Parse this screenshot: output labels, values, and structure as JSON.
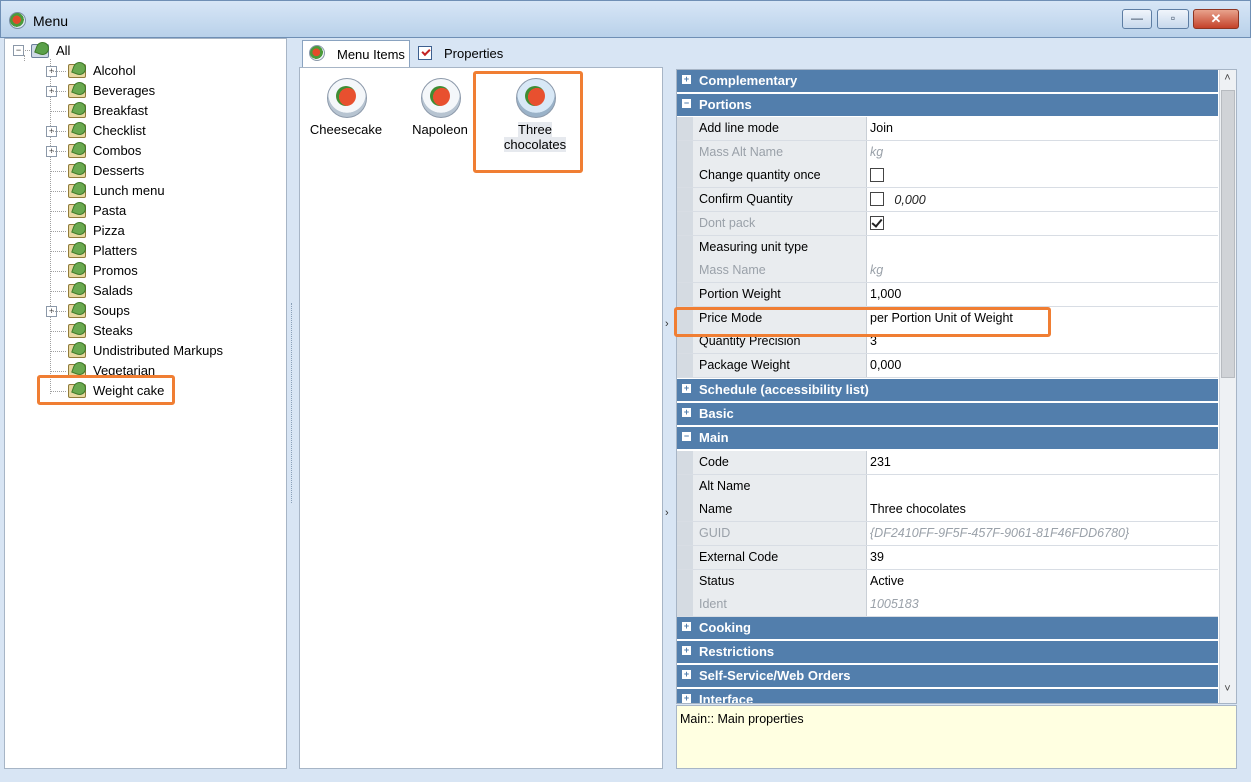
{
  "window": {
    "title": "Menu",
    "buttons": {
      "minimize": "—",
      "maximize": "▫",
      "close": "✕"
    }
  },
  "tree": {
    "root": "All",
    "items": [
      {
        "label": "Alcohol",
        "expandable": true
      },
      {
        "label": "Beverages",
        "expandable": true
      },
      {
        "label": "Breakfast",
        "expandable": false
      },
      {
        "label": "Checklist",
        "expandable": true
      },
      {
        "label": "Combos",
        "expandable": true
      },
      {
        "label": "Desserts",
        "expandable": false
      },
      {
        "label": "Lunch menu",
        "expandable": false
      },
      {
        "label": "Pasta",
        "expandable": false
      },
      {
        "label": "Pizza",
        "expandable": false
      },
      {
        "label": "Platters",
        "expandable": false
      },
      {
        "label": "Promos",
        "expandable": false
      },
      {
        "label": "Salads",
        "expandable": false
      },
      {
        "label": "Soups",
        "expandable": true
      },
      {
        "label": "Steaks",
        "expandable": false
      },
      {
        "label": "Undistributed Markups",
        "expandable": false
      },
      {
        "label": "Vegetarian",
        "expandable": false
      },
      {
        "label": "Weight cake",
        "expandable": false,
        "highlighted": true
      }
    ]
  },
  "tabs": {
    "menu_items": "Menu Items",
    "properties": "Properties"
  },
  "menu_items": [
    {
      "label": "Cheesecake"
    },
    {
      "label": "Napoleon"
    },
    {
      "label": "Three chocolates",
      "selected": true
    }
  ],
  "grid": {
    "categories": {
      "complementary": "Complementary",
      "portions": "Portions",
      "schedule": "Schedule (accessibility list)",
      "basic": "Basic",
      "main": "Main",
      "cooking": "Cooking",
      "restrictions": "Restrictions",
      "self_service": "Self-Service/Web Orders",
      "interface": "Interface"
    },
    "portions": [
      {
        "name": "Add line mode",
        "value": "Join"
      },
      {
        "name": "Mass Alt Name",
        "value": "kg",
        "dim": true,
        "italic": true
      },
      {
        "name": "Change quantity once",
        "checkbox": false
      },
      {
        "name": "Confirm Quantity",
        "checkbox": false,
        "value": "0,000",
        "italic": true
      },
      {
        "name": "Dont pack",
        "checkbox": true,
        "dim": true
      },
      {
        "name": "Measuring unit type",
        "value": ""
      },
      {
        "name": "Mass Name",
        "value": "kg",
        "dim": true,
        "italic": true
      },
      {
        "name": "Portion Weight",
        "value": "1,000"
      },
      {
        "name": "Price Mode",
        "value": "per Portion Unit of Weight",
        "highlighted": true
      },
      {
        "name": "Quantity Precision",
        "value": "3"
      },
      {
        "name": "Package Weight",
        "value": "0,000"
      }
    ],
    "main": [
      {
        "name": "Code",
        "value": "231"
      },
      {
        "name": "Alt Name",
        "value": ""
      },
      {
        "name": "Name",
        "value": "Three chocolates"
      },
      {
        "name": "GUID",
        "value": "{DF2410FF-9F5F-457F-9061-81F46FDD6780}",
        "dim": true,
        "italic": true
      },
      {
        "name": "External Code",
        "value": "39"
      },
      {
        "name": "Status",
        "value": "Active"
      },
      {
        "name": "Ident",
        "value": "1005183",
        "dim": true,
        "italic": true
      }
    ]
  },
  "description": "Main:: Main properties",
  "colors": {
    "highlight": "#f07e33",
    "category": "#527eac",
    "description_bg": "#ffffe1"
  }
}
